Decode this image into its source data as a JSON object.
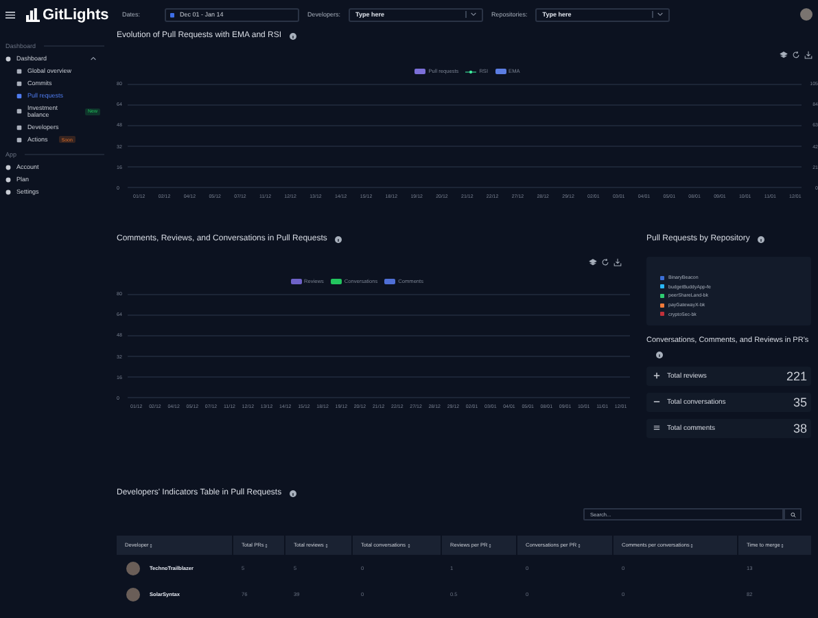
{
  "topbar": {
    "logo": "GitLights",
    "filters": [
      {
        "label": "Dates:",
        "kind": "date",
        "value": "Dec 01 - Jan 14"
      },
      {
        "label": "Developers:",
        "kind": "select",
        "placeholder": "Type here"
      },
      {
        "label": "Repositories:",
        "kind": "select",
        "placeholder": "Type here"
      }
    ]
  },
  "sidebar": {
    "sections": [
      {
        "title": "Dashboard",
        "items": [
          {
            "label": "Dashboard",
            "selected": false,
            "expanded": true,
            "children": [
              {
                "label": "Global overview",
                "selected": false
              },
              {
                "label": "Commits",
                "selected": false
              },
              {
                "label": "Pull requests",
                "selected": true
              },
              {
                "label": "Investment balance",
                "selected": false,
                "badge": {
                  "label": "New",
                  "kind": "new"
                }
              },
              {
                "label": "Developers",
                "selected": false
              },
              {
                "label": "Actions",
                "selected": false,
                "badge": {
                  "label": "Soon",
                  "kind": "soon"
                }
              }
            ]
          }
        ]
      },
      {
        "title": "App",
        "items": [
          {
            "label": "Account",
            "selected": false
          },
          {
            "label": "Plan",
            "selected": false
          },
          {
            "label": "Settings",
            "selected": false
          }
        ]
      }
    ]
  },
  "pr_evolution": {
    "title": "Evolution of Pull Requests with EMA and RSI",
    "legend": [
      {
        "label": "Pull requests",
        "kind": "box",
        "color": "#7b6fd8"
      },
      {
        "label": "RSI",
        "kind": "line",
        "color": "#3ef0a0"
      },
      {
        "label": "EMA",
        "kind": "box",
        "color": "#5b7de2"
      }
    ],
    "y_ticks": [
      "80",
      "64",
      "48",
      "32",
      "16",
      "0"
    ],
    "y2_ticks": [
      "105",
      "84",
      "63",
      "42",
      "21",
      "0"
    ],
    "x_labels": [
      "01/12",
      "02/12",
      "04/12",
      "05/12",
      "07/12",
      "11/12",
      "12/12",
      "13/12",
      "14/12",
      "15/12",
      "18/12",
      "19/12",
      "20/12",
      "21/12",
      "22/12",
      "27/12",
      "28/12",
      "29/12",
      "02/01",
      "03/01",
      "04/01",
      "05/01",
      "08/01",
      "09/01",
      "10/01",
      "11/01",
      "12/01"
    ]
  },
  "comments_chart": {
    "title": "Comments, Reviews, and Conversations in Pull Requests",
    "legend": [
      {
        "label": "Reviews",
        "kind": "box",
        "color": "#6e62c8"
      },
      {
        "label": "Conversations",
        "kind": "box",
        "color": "#22c55e"
      },
      {
        "label": "Comments",
        "kind": "box",
        "color": "#4f6fd6"
      }
    ],
    "y_ticks": [
      "80",
      "64",
      "48",
      "32",
      "16",
      "0"
    ],
    "x_labels": [
      "01/12",
      "02/12",
      "04/12",
      "05/12",
      "07/12",
      "11/12",
      "12/12",
      "13/12",
      "14/12",
      "15/12",
      "18/12",
      "19/12",
      "20/12",
      "21/12",
      "22/12",
      "27/12",
      "28/12",
      "29/12",
      "02/01",
      "03/01",
      "04/01",
      "05/01",
      "08/01",
      "09/01",
      "10/01",
      "11/01",
      "12/01"
    ]
  },
  "repo_panel": {
    "title": "Pull Requests by Repository",
    "repos": [
      {
        "label": "BinaryBeacon",
        "color": "#3b6fd8"
      },
      {
        "label": "budgetBuddyApp-fe",
        "color": "#29b6f6"
      },
      {
        "label": "peerShareLand-bk",
        "color": "#2ecc71"
      },
      {
        "label": "payGatewayX-bk",
        "color": "#f07a3a"
      },
      {
        "label": "cryptoSec-bk",
        "color": "#c0303a"
      }
    ]
  },
  "totals": {
    "title": "Conversations, Comments, and Reviews in PR's",
    "stats": [
      {
        "label": "Total reviews",
        "value": "221",
        "kind": "plus"
      },
      {
        "label": "Total conversations",
        "value": "35",
        "kind": "minus"
      },
      {
        "label": "Total comments",
        "value": "38",
        "kind": "equal"
      }
    ]
  },
  "table": {
    "title": "Developers' Indicators Table in Pull Requests",
    "search": {
      "placeholder": "Search..."
    },
    "columns": [
      "Developer",
      "Total PRs",
      "Total reviews",
      "Total conversations",
      "Reviews per PR",
      "Conversations per PR",
      "Comments per conversations",
      "Time to merge"
    ],
    "rows": [
      {
        "cells": [
          "TechnoTrailblazer",
          "5",
          "5",
          "0",
          "1",
          "0",
          "0",
          "13"
        ]
      },
      {
        "cells": [
          "SolarSyntax",
          "76",
          "39",
          "0",
          "0.5",
          "0",
          "0",
          "82"
        ]
      }
    ]
  }
}
